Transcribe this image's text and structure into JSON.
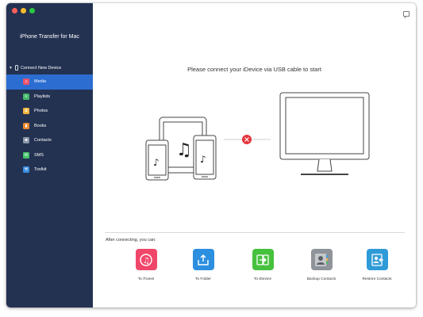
{
  "app": {
    "title": "iPhone Transfer for Mac"
  },
  "sidebar": {
    "device_header": "Connect New Device",
    "items": [
      {
        "label": "Media",
        "icon": "media-icon",
        "color": "#f0526b",
        "active": true
      },
      {
        "label": "Playlists",
        "icon": "playlist-icon",
        "color": "#45b86a"
      },
      {
        "label": "Photos",
        "icon": "photos-icon",
        "color": "#f2b63b"
      },
      {
        "label": "Books",
        "icon": "books-icon",
        "color": "#f08a2e"
      },
      {
        "label": "Contacts",
        "icon": "contacts-icon",
        "color": "#8b97a8"
      },
      {
        "label": "SMS",
        "icon": "sms-icon",
        "color": "#45c46a"
      },
      {
        "label": "Toolkit",
        "icon": "toolkit-icon",
        "color": "#3a8fe0"
      }
    ]
  },
  "main": {
    "prompt": "Please connect your iDevice via USB cable to start",
    "after_label": "After connecting, you can:"
  },
  "actions": [
    {
      "label": "To iTunes",
      "icon": "itunes-icon",
      "color": "#f0466a"
    },
    {
      "label": "To Folder",
      "icon": "folder-export-icon",
      "color": "#2d8fe0"
    },
    {
      "label": "To iDevice",
      "icon": "device-transfer-icon",
      "color": "#46c13d"
    },
    {
      "label": "Backup Contacts",
      "icon": "backup-contacts-icon",
      "color": "#8f949b"
    },
    {
      "label": "Restore Contacts",
      "icon": "restore-contacts-icon",
      "color": "#2f9ad8"
    }
  ],
  "colors": {
    "sidebar_bg": "#243252",
    "sidebar_active": "#2c6dd2",
    "disconnect": "#e5363c"
  }
}
